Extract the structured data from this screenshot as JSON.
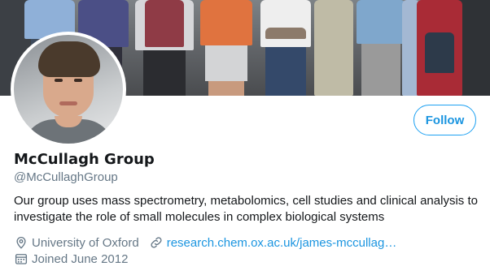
{
  "profile": {
    "name": "McCullagh Group",
    "handle": "@McCullaghGroup",
    "bio": "Our group uses mass spectrometry, metabolomics, cell studies and clinical analysis to investigate the role of small molecules in complex biological systems",
    "location": "University of Oxford",
    "website": "research.chem.ox.ac.uk/james-mccullag…",
    "joined": "Joined June 2012"
  },
  "actions": {
    "follow_label": "Follow"
  },
  "icons": {
    "location": "location-pin-icon",
    "website": "link-icon",
    "joined": "calendar-icon"
  },
  "colors": {
    "accent": "#1da1f2",
    "link": "#1b95e0",
    "secondary_text": "#657786",
    "primary_text": "#14171a"
  }
}
